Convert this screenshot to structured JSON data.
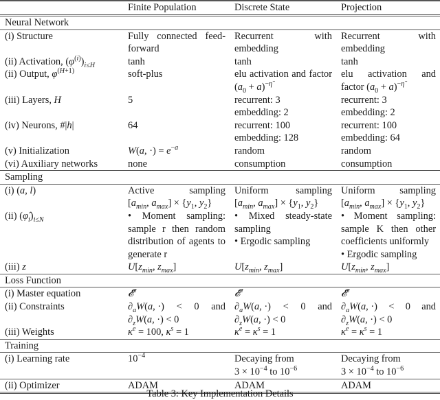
{
  "table": {
    "columns": [
      "",
      "Finite Population",
      "Discrete State",
      "Projection"
    ],
    "sections": [
      {
        "title": "Neural Network",
        "rows": [
          {
            "label": "(i) Structure",
            "cells": [
              "Fully connected feed-forward",
              "Recurrent with embedding",
              "Recurrent with embedding"
            ]
          },
          {
            "label": "(ii) Activation, (φ^(i))_{i≤H}",
            "cells": [
              "tanh",
              "tanh",
              "tanh"
            ]
          },
          {
            "label": "(ii) Output, φ^(H+1)",
            "cells": [
              "soft-plus",
              "elu activation and factor (a₀ + a)^(−η̃)",
              "elu activation and factor (a₀ + a)^(−η̃)"
            ]
          },
          {
            "label": "(iii) Layers, H",
            "cells": [
              "5",
              "recurrent: 3 / embedding: 2",
              "recurrent: 3 / embedding: 2"
            ]
          },
          {
            "label": "(iv) Neurons, #|h|",
            "cells": [
              "64",
              "recurrent: 100 / embedding: 128",
              "recurrent: 100 / embedding: 64"
            ]
          },
          {
            "label": "(v) Initialization",
            "cells": [
              "W(a,·) = e^(−a)",
              "random",
              "random"
            ]
          },
          {
            "label": "(vi) Auxiliary networks",
            "cells": [
              "none",
              "consumption",
              "consumption"
            ]
          }
        ]
      },
      {
        "title": "Sampling",
        "rows": [
          {
            "label": "(i) (a, l)",
            "cells": [
              "Active sampling [a_min, a_max] × {y₁, y₂}",
              "Uniform sampling [a_min, a_max] × {y₁, y₂}",
              "Uniform sampling [a_min, a_max] × {y₁, y₂}"
            ]
          },
          {
            "label": "(ii) (φ̂_i)_{i≤N}",
            "cells": [
              "• Moment sampling: sample r then random distribution of agents to generate r",
              "• Mixed steady-state sampling • Ergodic sampling",
              "• Moment sampling: sample K then other coefficients uniformly • Ergodic sampling"
            ]
          },
          {
            "label": "(iii) z",
            "cells": [
              "U[z_min, z_max]",
              "U[z_min, z_max]",
              "U[z_min, z_max]"
            ]
          }
        ]
      },
      {
        "title": "Loss Function",
        "rows": [
          {
            "label": "(i) Master equation",
            "cells": [
              "𝓔^e",
              "𝓔^e",
              "𝓔^e"
            ]
          },
          {
            "label": "(ii) Constraints",
            "cells": [
              "∂_a W(a,·) < 0 and ∂_z W(a,·) < 0",
              "∂_a W(a,·) < 0 and ∂_z W(a,·) < 0",
              "∂_a W(a,·) < 0 and ∂_z W(a,·) < 0"
            ]
          },
          {
            "label": "(iii) Weights",
            "cells": [
              "κ^e = 100, κ^s = 1",
              "κ^e = κ^s = 1",
              "κ^e = κ^s = 1"
            ]
          }
        ]
      },
      {
        "title": "Training",
        "rows": [
          {
            "label": "(i) Learning rate",
            "cells": [
              "10^(−4)",
              "Decaying from 3 × 10^(−4) to 10^(−6)",
              "Decaying from 3 × 10^(−4) to 10^(−6)"
            ]
          },
          {
            "label": "(ii) Optimizer",
            "cells": [
              "ADAM",
              "ADAM",
              "ADAM"
            ]
          }
        ]
      }
    ]
  },
  "text": {
    "h1": "Finite Population",
    "h2": "Discrete State",
    "h3": "Projection",
    "s_nn": "Neural Network",
    "s_samp": "Sampling",
    "s_loss": "Loss Function",
    "s_train": "Training",
    "l_structure": "(i) Structure",
    "l_activation_pre": "(ii) Activation, ",
    "l_output_pre": "(ii) Output, ",
    "l_layers_pre": "(iii) Layers, ",
    "l_neurons_pre": "(iv) Neurons, ",
    "l_init": "(v) Initialization",
    "l_aux": "(vi) Auxiliary networks",
    "l_al_pre": "(i) ",
    "l_phi_pre": "(ii) ",
    "l_z_pre": "(iii) ",
    "l_master": "(i) Master equation",
    "l_constraints": "(ii) Constraints",
    "l_weights": "(iii) Weights",
    "l_lr": "(i) Learning rate",
    "l_opt": "(ii) Optimizer",
    "fp_structure": "Fully connected feed-forward",
    "ds_structure": "Recurrent with embedding",
    "pr_structure": "Recurrent with embedding",
    "tanh": "tanh",
    "fp_output": "soft-plus",
    "elu_text": "elu activation and factor ",
    "fp_layers": "5",
    "ds_layers_1": "recurrent: 3",
    "ds_layers_2": "embedding: 2",
    "pr_layers_1": "recurrent: 3",
    "pr_layers_2": "embedding: 2",
    "fp_neurons": "64",
    "ds_neurons_1": "recurrent: 100",
    "ds_neurons_2": "embedding: 128",
    "pr_neurons_1": "recurrent: 100",
    "pr_neurons_2": "embedding: 64",
    "random": "random",
    "fp_aux": "none",
    "consumption": "consumption",
    "fp_al": "Active sampling",
    "uniform_sampling": "Uniform sampling",
    "fp_phi": "• Moment sampling: sample r then random distribution of agents to generate r",
    "ds_phi_1": "• Mixed steady-state sampling",
    "ds_phi_2": "• Ergodic sampling",
    "pr_phi_1": "• Moment sampling: sample K then other coefficients uniformly",
    "pr_phi_2": "• Ergodic sampling",
    "and": "and",
    "fp_weights": "κᵉ = 100, κˢ = 1",
    "eq_weights": "κᵉ = κˢ = 1",
    "decaying": "Decaying from",
    "adam": "ADAM",
    "caption": "Table 3: Key Implementation Details"
  }
}
